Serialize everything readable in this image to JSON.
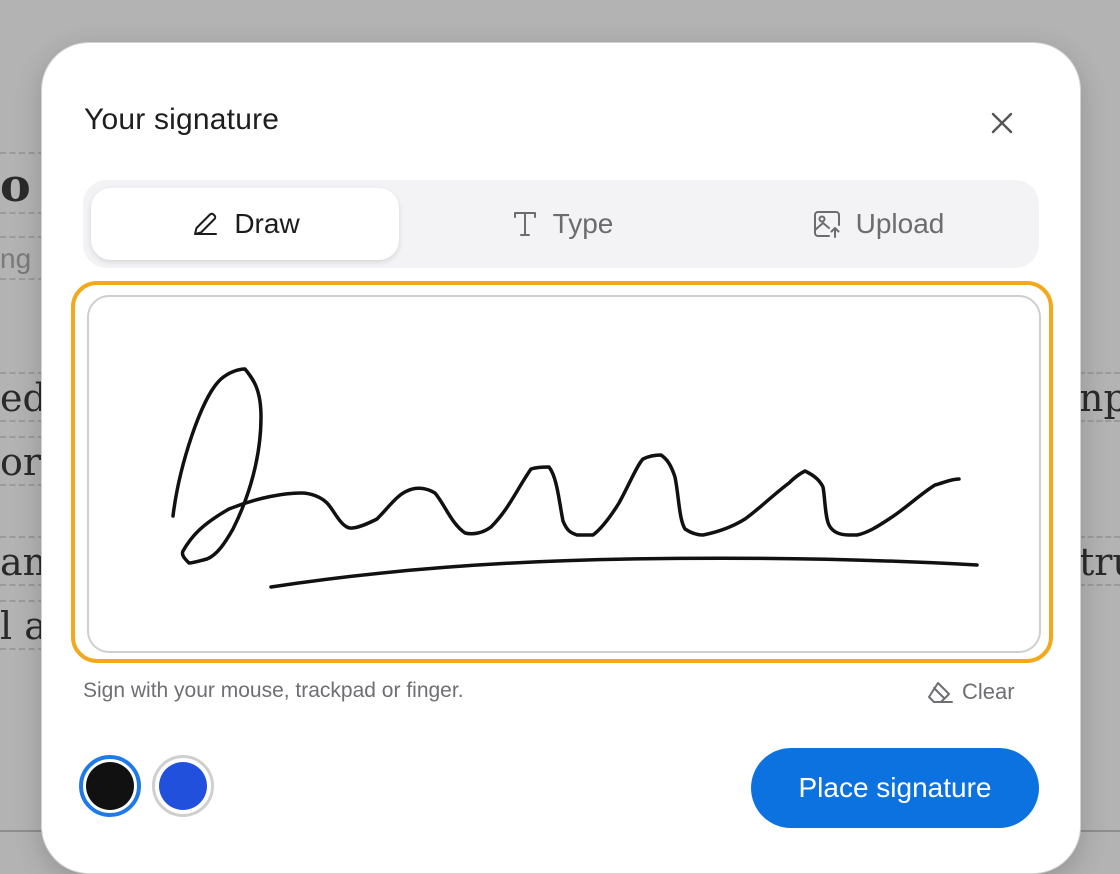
{
  "background_document": {
    "fragments_left": [
      "o",
      "ng",
      "ed,",
      "or t",
      "am",
      "l at"
    ],
    "fragments_right": [
      "npa",
      "tru"
    ]
  },
  "dialog": {
    "title": "Your signature",
    "close_icon": "close-icon",
    "tabs": [
      {
        "label": "Draw",
        "icon": "pencil-icon",
        "active": true
      },
      {
        "label": "Type",
        "icon": "text-icon",
        "active": false
      },
      {
        "label": "Upload",
        "icon": "image-upload-icon",
        "active": false
      }
    ],
    "pad": {
      "focus_color": "#f4a81c",
      "stroke_color": "#111111"
    },
    "hint": "Sign with your mouse, trackpad or finger.",
    "clear_label": "Clear",
    "clear_icon": "eraser-icon",
    "colors": [
      {
        "name": "black",
        "hex": "#111111",
        "selected": true
      },
      {
        "name": "blue",
        "hex": "#2150dc",
        "selected": false
      }
    ],
    "place_label": "Place signature",
    "accent_color": "#0c72df"
  }
}
